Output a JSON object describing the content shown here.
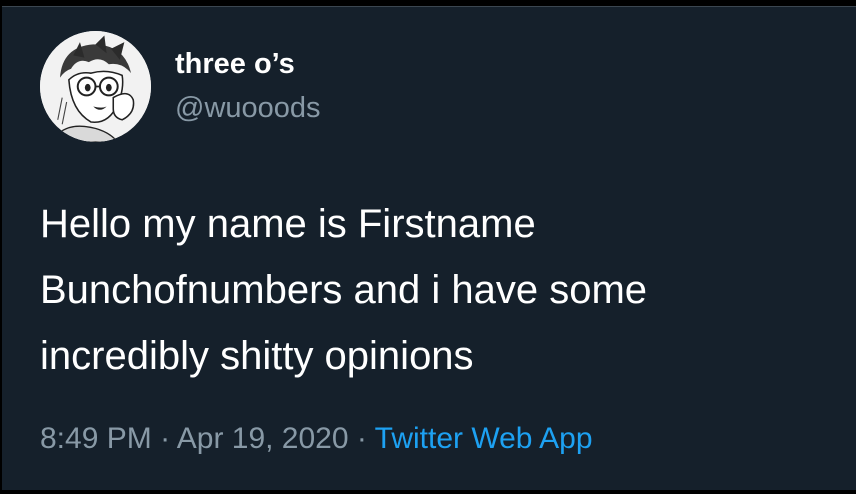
{
  "tweet": {
    "display_name": "three o’s",
    "handle": "@wuooods",
    "text_lines": [
      "Hello my name is Firstname",
      "Bunchofnumbers and i have some",
      "incredibly shitty opinions"
    ],
    "time": "8:49 PM",
    "separator": " · ",
    "date": "Apr 19, 2020",
    "source": "Twitter Web App",
    "avatar_icon": "anime-character-avatar-icon"
  },
  "colors": {
    "background": "#15202b",
    "text": "#ffffff",
    "secondary_text": "#8899a6",
    "link": "#1da1f2"
  }
}
